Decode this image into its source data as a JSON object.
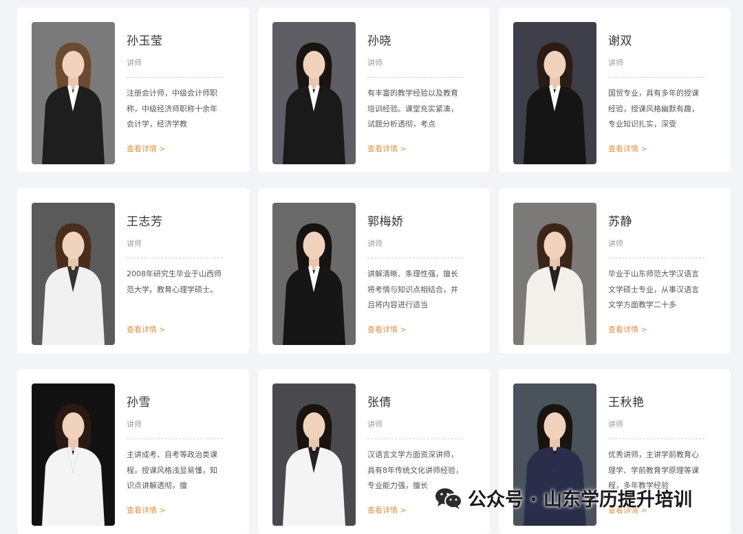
{
  "details_label": "查看详情 >",
  "teachers": [
    {
      "name": "孙玉莹",
      "role": "讲师",
      "desc": "注册会计师，中级会计师职称，中级经济师职称十余年会计学，经济学教",
      "bg": "#7a7a7a",
      "suit": "#1e1e1e",
      "hair": "#6b4a2e",
      "shirt": "#ffffff"
    },
    {
      "name": "孙晓",
      "role": "讲师",
      "desc": "有丰富的教学经验以及教育培训经验。课堂充实紧凑，试题分析透彻，考点",
      "bg": "#5e5e64",
      "suit": "#1a1a1a",
      "hair": "#1a1410",
      "shirt": "#ffffff"
    },
    {
      "name": "谢双",
      "role": "讲师",
      "desc": "国贸专业，具有多年的授课经验，授课风格幽默有趣，专业知识扎实，深受",
      "bg": "#3f3f4a",
      "suit": "#151515",
      "hair": "#2a1c14",
      "shirt": "#ffffff"
    },
    {
      "name": "王志芳",
      "role": "讲师",
      "desc": "2008年研究生毕业于山西师范大学。教育心理学硕士。",
      "bg": "#5a5a5a",
      "suit": "#f0f0f0",
      "hair": "#4a2e1c",
      "shirt": "#333333"
    },
    {
      "name": "郭梅娇",
      "role": "讲师",
      "desc": "讲解清晰、条理性强，擅长将考情与知识点相结合，并且将内容进行适当",
      "bg": "#6a6a6a",
      "suit": "#161616",
      "hair": "#161210",
      "shirt": "#ffffff"
    },
    {
      "name": "苏静",
      "role": "讲师",
      "desc": "毕业于山东师范大学汉语言文学硕士专业，从事汉语言文学方面教学二十多",
      "bg": "#7c7a78",
      "suit": "#f2f0ea",
      "hair": "#3a2618",
      "shirt": "#222222"
    },
    {
      "name": "孙雪",
      "role": "讲师",
      "desc": "主讲成考、自考等政治类课程，授课风格浅显易懂，知识点讲解透彻，擅",
      "bg": "#121212",
      "suit": "#f4f4f4",
      "hair": "#2a1a12",
      "shirt": "#f4f4f4"
    },
    {
      "name": "张倩",
      "role": "讲师",
      "desc": "汉语言文学方面资深讲师，具有8年传统文化讲师经验，专业能力强，擅长",
      "bg": "#4a4a4e",
      "suit": "#f4f4f4",
      "hair": "#1a1410",
      "shirt": "#222222"
    },
    {
      "name": "王秋艳",
      "role": "讲师",
      "desc": "优秀讲师，主讲学前教育心理学、学前教育学原理等课程，多年教学经验",
      "bg": "#4a535c",
      "suit": "#2a2e4a",
      "hair": "#1a1410",
      "shirt": "#2a2e4a"
    }
  ],
  "watermark": {
    "text": "公众号 · 山东学历提升培训",
    "icon": "wechat-icon"
  }
}
